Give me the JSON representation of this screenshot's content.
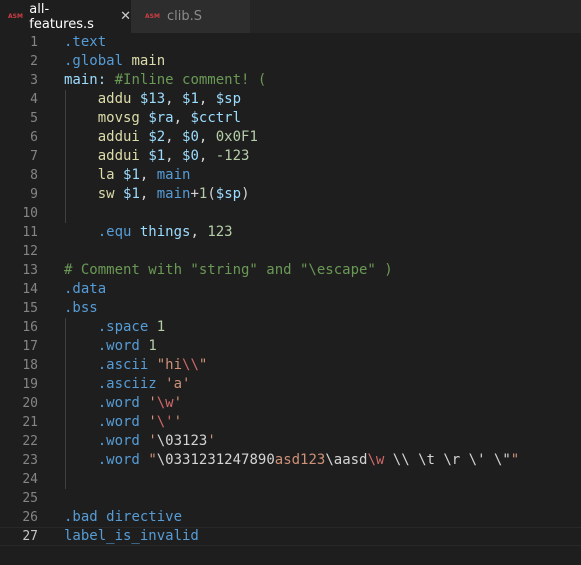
{
  "tabs": [
    {
      "label": "all-features.s",
      "icon": "ASM",
      "active": true,
      "close": "✕"
    },
    {
      "label": "clib.S",
      "icon": "ASM",
      "active": false
    }
  ],
  "colors": {
    "background": "#1e1e1e",
    "keyword": "#569cd6",
    "instruction": "#dcdcaa",
    "register": "#9cdcfe",
    "number": "#b5cea8",
    "comment": "#6a9955",
    "string": "#ce9178",
    "escape": "#d16969"
  },
  "lines": [
    {
      "n": "1",
      "tokens": [
        [
          "keyword",
          ".text"
        ]
      ]
    },
    {
      "n": "2",
      "tokens": [
        [
          "keyword",
          ".global"
        ],
        [
          "plain",
          " "
        ],
        [
          "instruction",
          "main"
        ]
      ]
    },
    {
      "n": "3",
      "tokens": [
        [
          "label",
          "main:"
        ],
        [
          "plain",
          " "
        ],
        [
          "comment",
          "#Inline comment! ("
        ]
      ]
    },
    {
      "n": "4",
      "tokens": [
        [
          "plain",
          "    "
        ],
        [
          "instruction",
          "addu"
        ],
        [
          "plain",
          " "
        ],
        [
          "register",
          "$13"
        ],
        [
          "plain",
          ", "
        ],
        [
          "register",
          "$1"
        ],
        [
          "plain",
          ", "
        ],
        [
          "register",
          "$sp"
        ]
      ]
    },
    {
      "n": "5",
      "tokens": [
        [
          "plain",
          "    "
        ],
        [
          "instruction",
          "movsg"
        ],
        [
          "plain",
          " "
        ],
        [
          "register",
          "$ra"
        ],
        [
          "plain",
          ", "
        ],
        [
          "register",
          "$cctrl"
        ]
      ]
    },
    {
      "n": "6",
      "tokens": [
        [
          "plain",
          "    "
        ],
        [
          "instruction",
          "addui"
        ],
        [
          "plain",
          " "
        ],
        [
          "register",
          "$2"
        ],
        [
          "plain",
          ", "
        ],
        [
          "register",
          "$0"
        ],
        [
          "plain",
          ", "
        ],
        [
          "number",
          "0x0F1"
        ]
      ]
    },
    {
      "n": "7",
      "tokens": [
        [
          "plain",
          "    "
        ],
        [
          "instruction",
          "addui"
        ],
        [
          "plain",
          " "
        ],
        [
          "register",
          "$1"
        ],
        [
          "plain",
          ", "
        ],
        [
          "register",
          "$0"
        ],
        [
          "plain",
          ", "
        ],
        [
          "number",
          "-123"
        ]
      ]
    },
    {
      "n": "8",
      "tokens": [
        [
          "plain",
          "    "
        ],
        [
          "instruction",
          "la"
        ],
        [
          "plain",
          " "
        ],
        [
          "register",
          "$1"
        ],
        [
          "plain",
          ", "
        ],
        [
          "keyword",
          "main"
        ]
      ]
    },
    {
      "n": "9",
      "tokens": [
        [
          "plain",
          "    "
        ],
        [
          "instruction",
          "sw"
        ],
        [
          "plain",
          " "
        ],
        [
          "register",
          "$1"
        ],
        [
          "plain",
          ", "
        ],
        [
          "keyword",
          "main"
        ],
        [
          "plain",
          "+"
        ],
        [
          "number",
          "1"
        ],
        [
          "plain",
          "("
        ],
        [
          "register",
          "$sp"
        ],
        [
          "plain",
          ")"
        ]
      ]
    },
    {
      "n": "10",
      "tokens": []
    },
    {
      "n": "11",
      "tokens": [
        [
          "plain",
          "    "
        ],
        [
          "keyword",
          ".equ"
        ],
        [
          "plain",
          " "
        ],
        [
          "register",
          "things"
        ],
        [
          "plain",
          ", "
        ],
        [
          "number",
          "123"
        ]
      ]
    },
    {
      "n": "12",
      "tokens": []
    },
    {
      "n": "13",
      "tokens": [
        [
          "comment",
          "# Comment with \"string\" and \"\\escape\" )"
        ]
      ]
    },
    {
      "n": "14",
      "tokens": [
        [
          "keyword",
          ".data"
        ]
      ]
    },
    {
      "n": "15",
      "tokens": [
        [
          "keyword",
          ".bss"
        ]
      ]
    },
    {
      "n": "16",
      "tokens": [
        [
          "plain",
          "    "
        ],
        [
          "keyword",
          ".space"
        ],
        [
          "plain",
          " "
        ],
        [
          "number",
          "1"
        ]
      ]
    },
    {
      "n": "17",
      "tokens": [
        [
          "plain",
          "    "
        ],
        [
          "keyword",
          ".word"
        ],
        [
          "plain",
          " "
        ],
        [
          "number",
          "1"
        ]
      ]
    },
    {
      "n": "18",
      "tokens": [
        [
          "plain",
          "    "
        ],
        [
          "keyword",
          ".ascii"
        ],
        [
          "plain",
          " "
        ],
        [
          "string",
          "\"hi"
        ],
        [
          "escape",
          "\\\\"
        ],
        [
          "string",
          "\""
        ]
      ]
    },
    {
      "n": "19",
      "tokens": [
        [
          "plain",
          "    "
        ],
        [
          "keyword",
          ".asciiz"
        ],
        [
          "plain",
          " "
        ],
        [
          "string",
          "'a'"
        ]
      ]
    },
    {
      "n": "20",
      "tokens": [
        [
          "plain",
          "    "
        ],
        [
          "keyword",
          ".word"
        ],
        [
          "plain",
          " "
        ],
        [
          "string",
          "'"
        ],
        [
          "escape",
          "\\w"
        ],
        [
          "string",
          "'"
        ]
      ]
    },
    {
      "n": "21",
      "tokens": [
        [
          "plain",
          "    "
        ],
        [
          "keyword",
          ".word"
        ],
        [
          "plain",
          " "
        ],
        [
          "string",
          "'"
        ],
        [
          "escape",
          "\\'"
        ],
        [
          "string",
          "'"
        ]
      ]
    },
    {
      "n": "22",
      "tokens": [
        [
          "plain",
          "    "
        ],
        [
          "keyword",
          ".word"
        ],
        [
          "plain",
          " "
        ],
        [
          "string",
          "'"
        ],
        [
          "plain",
          "\\03123"
        ],
        [
          "string",
          "'"
        ]
      ]
    },
    {
      "n": "23",
      "tokens": [
        [
          "plain",
          "    "
        ],
        [
          "keyword",
          ".word"
        ],
        [
          "plain",
          " "
        ],
        [
          "string",
          "\""
        ],
        [
          "plain",
          "\\0331231247890"
        ],
        [
          "string",
          "asd123"
        ],
        [
          "plain",
          "\\aasd"
        ],
        [
          "escape",
          "\\w"
        ],
        [
          "plain",
          " \\\\ \\t \\r \\' \\\""
        ],
        [
          "string",
          "\""
        ]
      ]
    },
    {
      "n": "24",
      "tokens": []
    },
    {
      "n": "25",
      "tokens": []
    },
    {
      "n": "26",
      "tokens": [
        [
          "keyword",
          ".bad"
        ],
        [
          "plain",
          " "
        ],
        [
          "keyword",
          "directive"
        ]
      ]
    },
    {
      "n": "27",
      "tokens": [
        [
          "keyword",
          "label_is_invalid"
        ]
      ],
      "current": true
    }
  ]
}
